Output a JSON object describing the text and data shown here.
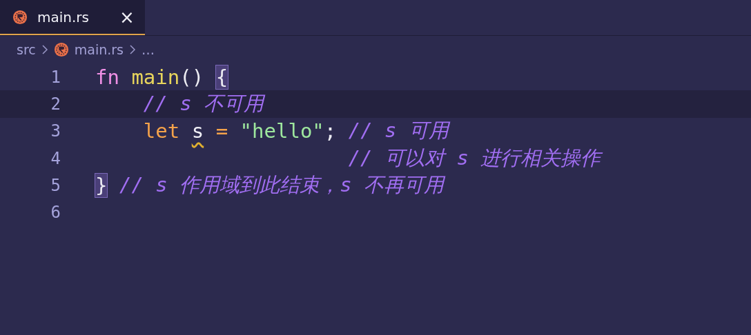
{
  "tabs": [
    {
      "label": "main.rs",
      "selected": true,
      "close": "×"
    }
  ],
  "breadcrumb": [
    {
      "label": "src",
      "kind": "folder"
    },
    {
      "label": "main.rs",
      "kind": "file"
    },
    {
      "label": "…",
      "kind": "symbol"
    }
  ],
  "lines": [
    {
      "number": "1",
      "current": false,
      "tokens": [
        {
          "kind": "keyword",
          "text": "fn"
        },
        {
          "kind": "function",
          "text": " main"
        },
        {
          "kind": "punct",
          "text": "()"
        },
        {
          "kind": "bracket-match",
          "text": " {"
        }
      ]
    },
    {
      "number": "2",
      "current": true,
      "tokens": [
        {
          "kind": "comment",
          "text": "    // s 不可用"
        }
      ]
    },
    {
      "number": "3",
      "current": false,
      "tokens": [
        {
          "kind": "keyword-let",
          "text": "    let"
        },
        {
          "kind": "variable",
          "text": " s",
          "warning": true
        },
        {
          "kind": "operator",
          "text": " ="
        },
        {
          "kind": "string",
          "text": " \"hello\""
        },
        {
          "kind": "punct",
          "text": ";"
        },
        {
          "kind": "comment",
          "text": " // s 可用"
        }
      ]
    },
    {
      "number": "4",
      "current": false,
      "tokens": [
        {
          "kind": "comment",
          "text": "                     // 可以对 s 进行相关操作"
        }
      ]
    },
    {
      "number": "5",
      "current": false,
      "tokens": [
        {
          "kind": "bracket-match",
          "text": "}"
        },
        {
          "kind": "comment",
          "text": " // s 作用域到此结束，s 不再可用"
        }
      ]
    },
    {
      "number": "6",
      "current": false
    }
  ]
}
